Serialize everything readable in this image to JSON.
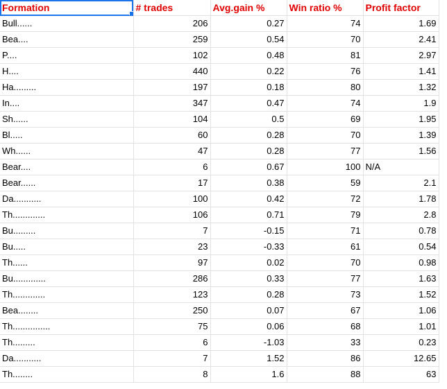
{
  "theme": {
    "header_text_color": "#e00000",
    "body_text_color": "#000000",
    "gridline_color": "#e2e2e2",
    "selection_color": "#1a73e8"
  },
  "sheet": {
    "selected_cell": "A1",
    "headers": [
      "Formation",
      "# trades",
      "Avg.gain %",
      "Win ratio %",
      "Profit factor"
    ],
    "rows": [
      [
        "Bull......",
        "206",
        "0.27",
        "74",
        "1.69"
      ],
      [
        "Bea....",
        "259",
        "0.54",
        "70",
        "2.41"
      ],
      [
        "P....",
        "102",
        "0.48",
        "81",
        "2.97"
      ],
      [
        "H....",
        "440",
        "0.22",
        "76",
        "1.41"
      ],
      [
        "Ha.........",
        "197",
        "0.18",
        "80",
        "1.32"
      ],
      [
        "In....",
        "347",
        "0.47",
        "74",
        "1.9"
      ],
      [
        "Sh......",
        "104",
        "0.5",
        "69",
        "1.95"
      ],
      [
        "Bl.....",
        "60",
        "0.28",
        "70",
        "1.39"
      ],
      [
        "Wh......",
        "47",
        "0.28",
        "77",
        "1.56"
      ],
      [
        "Bear....",
        "6",
        "0.67",
        "100",
        "N/A"
      ],
      [
        "Bear......",
        "17",
        "0.38",
        "59",
        "2.1"
      ],
      [
        "Da...........",
        "100",
        "0.42",
        "72",
        "1.78"
      ],
      [
        "Th.............",
        "106",
        "0.71",
        "79",
        "2.8"
      ],
      [
        "Bu.........",
        "7",
        "-0.15",
        "71",
        "0.78"
      ],
      [
        "Bu.....",
        "23",
        "-0.33",
        "61",
        "0.54"
      ],
      [
        "Th......",
        "97",
        "0.02",
        "70",
        "0.98"
      ],
      [
        "Bu.............",
        "286",
        "0.33",
        "77",
        "1.63"
      ],
      [
        "Th.............",
        "123",
        "0.28",
        "73",
        "1.52"
      ],
      [
        "Bea........",
        "250",
        "0.07",
        "67",
        "1.06"
      ],
      [
        "Th...............",
        "75",
        "0.06",
        "68",
        "1.01"
      ],
      [
        "Th.........",
        "6",
        "-1.03",
        "33",
        "0.23"
      ],
      [
        "Da...........",
        "7",
        "1.52",
        "86",
        "12.65"
      ],
      [
        "Th........",
        "8",
        "1.6",
        "88",
        "63"
      ]
    ]
  }
}
